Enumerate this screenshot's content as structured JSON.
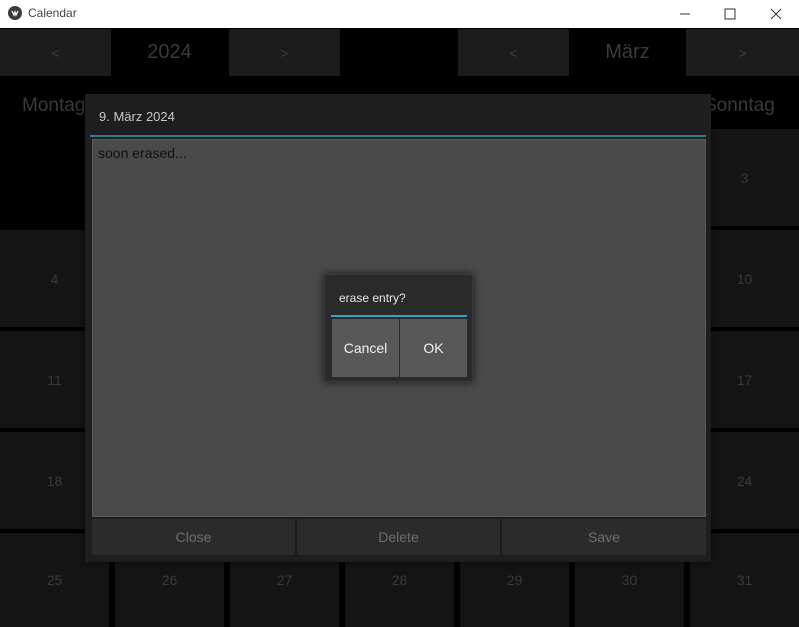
{
  "window": {
    "title": "Calendar",
    "minimize_icon": "minimize-icon",
    "maximize_icon": "maximize-icon",
    "close_icon": "close-icon"
  },
  "calendar": {
    "year_prev": "<",
    "year": "2024",
    "year_next": ">",
    "month_prev": "<",
    "month": "März",
    "month_next": ">",
    "day_headers": {
      "first": "Montag",
      "last": "Sonntag"
    },
    "days": {
      "d3": "3",
      "d4": "4",
      "d10": "10",
      "d11": "11",
      "d17": "17",
      "d18": "18",
      "d24": "24",
      "d25": "25",
      "d26": "26",
      "d27": "27",
      "d28": "28",
      "d29": "29",
      "d30": "30",
      "d31": "31"
    }
  },
  "entry_dialog": {
    "date": "9. März 2024",
    "text": "soon erased...",
    "close_label": "Close",
    "delete_label": "Delete",
    "save_label": "Save"
  },
  "confirm_popup": {
    "title": "erase entry?",
    "cancel_label": "Cancel",
    "ok_label": "OK"
  },
  "colors": {
    "accent": "#38a0c0",
    "dialog_bg": "#1e1e1e",
    "text_area_bg": "#4a4a4a",
    "titlebar_bg": "#ffffff"
  }
}
